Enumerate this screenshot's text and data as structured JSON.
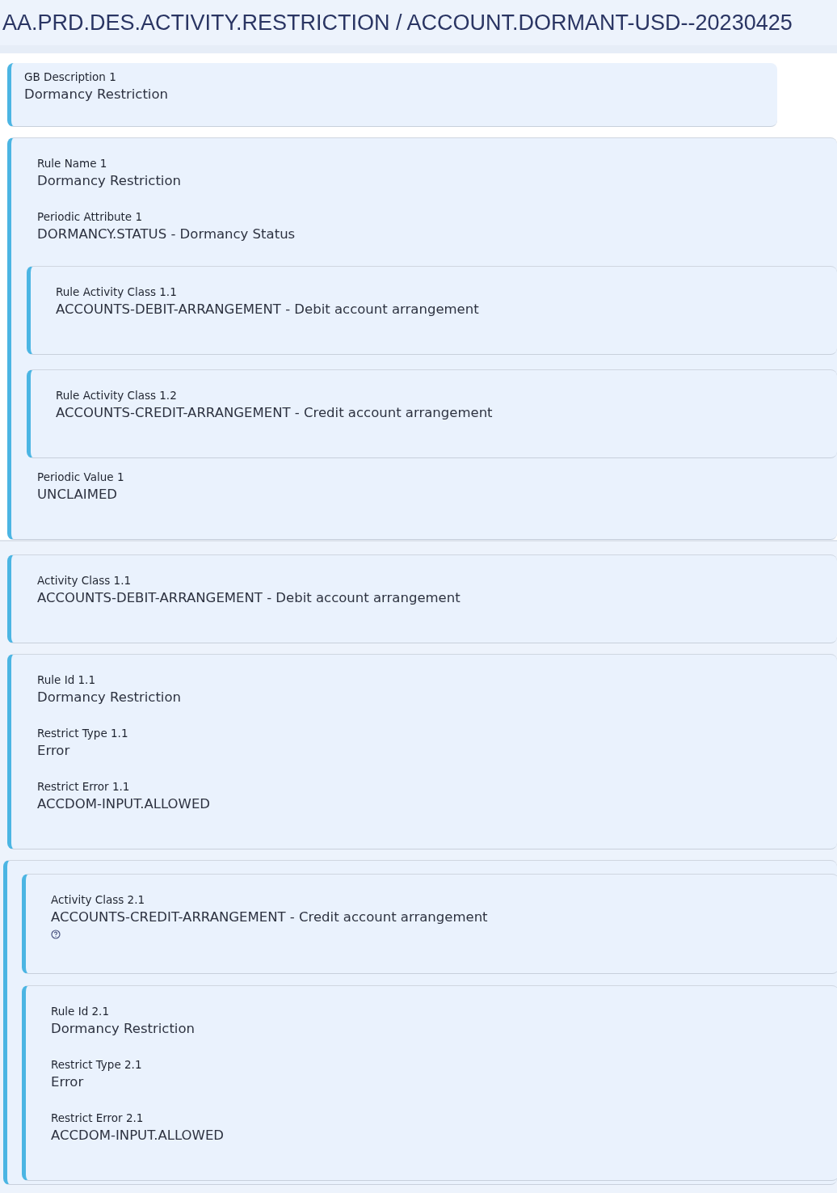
{
  "title": "AA.PRD.DES.ACTIVITY.RESTRICTION / ACCOUNT.DORMANT-USD--20230425",
  "groups": [
    {
      "kind": "plain",
      "sections": [
        {
          "kind": "short",
          "items": [
            {
              "kind": "field",
              "label": "GB Description 1",
              "value": "Dormancy Restriction"
            }
          ]
        },
        {
          "kind": "full",
          "items": [
            {
              "kind": "field",
              "label": "Rule Name 1",
              "value": "Dormancy Restriction"
            },
            {
              "kind": "field",
              "label": "Periodic Attribute 1",
              "value": "DORMANCY.STATUS - Dormancy Status"
            },
            {
              "kind": "panel",
              "items": [
                {
                  "kind": "field",
                  "label": "Rule Activity Class 1.1",
                  "value": "ACCOUNTS-DEBIT-ARRANGEMENT - Debit account arrangement"
                }
              ]
            },
            {
              "kind": "panel",
              "items": [
                {
                  "kind": "field",
                  "label": "Rule Activity Class 1.2",
                  "value": "ACCOUNTS-CREDIT-ARRANGEMENT - Credit account arrangement"
                }
              ]
            },
            {
              "kind": "field",
              "label": "Periodic Value 1",
              "value": "UNCLAIMED"
            }
          ]
        }
      ]
    },
    {
      "kind": "shaded",
      "sections": [
        {
          "kind": "full",
          "items": [
            {
              "kind": "field",
              "label": "Activity Class 1.1",
              "value": "ACCOUNTS-DEBIT-ARRANGEMENT - Debit account arrangement"
            }
          ]
        },
        {
          "kind": "full",
          "items": [
            {
              "kind": "field",
              "label": "Rule Id 1.1",
              "value": "Dormancy Restriction"
            },
            {
              "kind": "field",
              "label": "Restrict Type 1.1",
              "value": "Error"
            },
            {
              "kind": "field",
              "label": "Restrict Error 1.1",
              "value": "ACCDOM-INPUT.ALLOWED"
            }
          ]
        },
        {
          "kind": "outer",
          "items": [
            {
              "kind": "panel",
              "items": [
                {
                  "kind": "field",
                  "label": "Activity Class 2.1",
                  "value": "ACCOUNTS-CREDIT-ARRANGEMENT - Credit account arrangement",
                  "help": true
                }
              ]
            },
            {
              "kind": "panel",
              "items": [
                {
                  "kind": "field",
                  "label": "Rule Id 2.1",
                  "value": "Dormancy Restriction"
                },
                {
                  "kind": "field",
                  "label": "Restrict Type 2.1",
                  "value": "Error"
                },
                {
                  "kind": "field",
                  "label": "Restrict Error 2.1",
                  "value": "ACCDOM-INPUT.ALLOWED"
                }
              ]
            }
          ]
        }
      ]
    }
  ]
}
